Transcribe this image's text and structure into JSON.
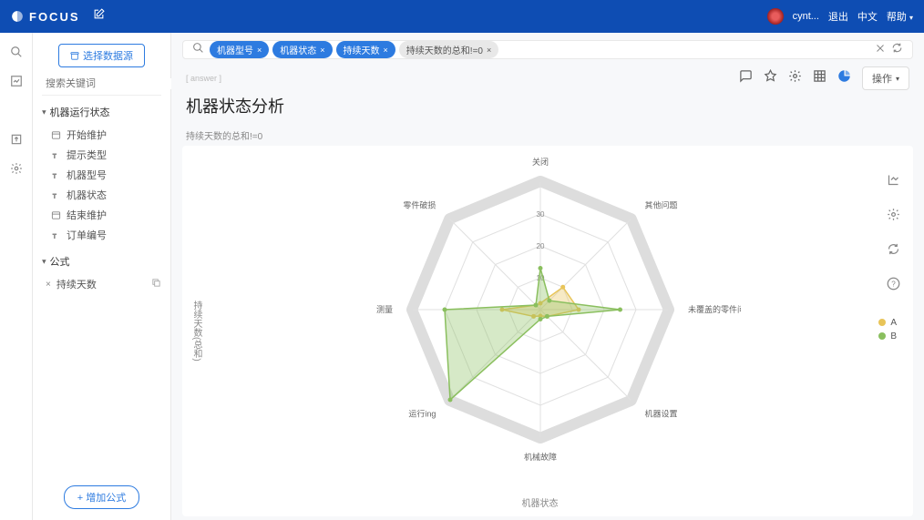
{
  "header": {
    "logo_text": "FOCUS",
    "username": "cynt...",
    "logout": "退出",
    "lang": "中文",
    "help": "帮助"
  },
  "sidebar": {
    "select_source_btn": "选择数据源",
    "search_placeholder": "搜索关键词",
    "section1_title": "机器运行状态",
    "section1_items": [
      "开始维护",
      "提示类型",
      "机器型号",
      "机器状态",
      "结束维护",
      "订单编号"
    ],
    "section2_title": "公式",
    "formula_items": [
      "持续天数"
    ],
    "add_formula_btn": "+ 增加公式"
  },
  "query": {
    "pills": [
      {
        "label": "机器型号",
        "blue": true
      },
      {
        "label": "机器状态",
        "blue": true
      },
      {
        "label": "持续天数",
        "blue": true
      },
      {
        "label": "持续天数的总和!=0",
        "blue": false
      }
    ]
  },
  "report": {
    "breadcrumb": "[ answer ]",
    "title": "机器状态分析",
    "filter_note": "持续天数的总和!=0",
    "ops_btn": "操作",
    "y_axis": "持续天数(总和)",
    "x_axis": "机器状态"
  },
  "chart_data": {
    "type": "radar",
    "categories": [
      "关闭",
      "其他问题",
      "未覆盖的零件问题",
      "机器设置",
      "机械故障",
      "运行ing",
      "测量",
      "零件破损"
    ],
    "ticks": [
      10,
      20,
      30
    ],
    "max": 40,
    "series": [
      {
        "name": "A",
        "color": "#e8c458",
        "values": [
          2,
          10,
          12,
          3,
          2,
          3,
          12,
          2
        ]
      },
      {
        "name": "B",
        "color": "#8abf5e",
        "values": [
          13,
          4,
          25,
          3,
          3,
          40,
          30,
          2
        ]
      }
    ]
  }
}
